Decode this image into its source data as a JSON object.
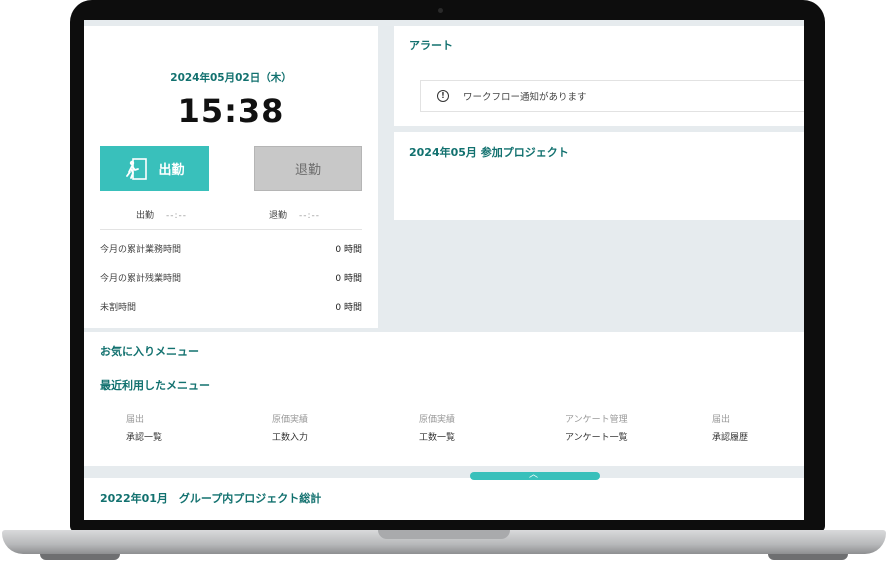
{
  "time_card": {
    "date": "2024年05月02日（木）",
    "clock": "15:38",
    "clock_in_label": "出勤",
    "clock_out_label": "退勤",
    "clock_in_record_label": "出勤",
    "clock_in_record_time": "--:--",
    "clock_out_record_label": "退勤",
    "clock_out_record_time": "--:--",
    "stats": [
      {
        "label": "今月の累計業務時間",
        "value": "0 時間"
      },
      {
        "label": "今月の累計残業時間",
        "value": "0 時間"
      },
      {
        "label": "未割時間",
        "value": "0 時間"
      }
    ]
  },
  "alert": {
    "title": "アラート",
    "message": "ワークフロー通知があります"
  },
  "projects": {
    "title": "2024年05月 参加プロジェクト"
  },
  "menu": {
    "favorites_title": "お気に入りメニュー",
    "recent_title": "最近利用したメニュー",
    "recent_items": [
      {
        "category": "届出",
        "name": "承認一覧"
      },
      {
        "category": "原価実績",
        "name": "工数入力"
      },
      {
        "category": "原価実績",
        "name": "工数一覧"
      },
      {
        "category": "アンケート管理",
        "name": "アンケート一覧"
      },
      {
        "category": "届出",
        "name": "承認履歴"
      }
    ]
  },
  "group_projects": {
    "title": "2022年01月　グループ内プロジェクト総計"
  },
  "colors": {
    "accent": "#39c0bb",
    "heading": "#12716f",
    "background": "#e6ebee"
  },
  "icons": {
    "clock_in": "exit-run-icon",
    "alert": "exclamation-circle-icon",
    "collapse": "chevron-up-icon"
  }
}
